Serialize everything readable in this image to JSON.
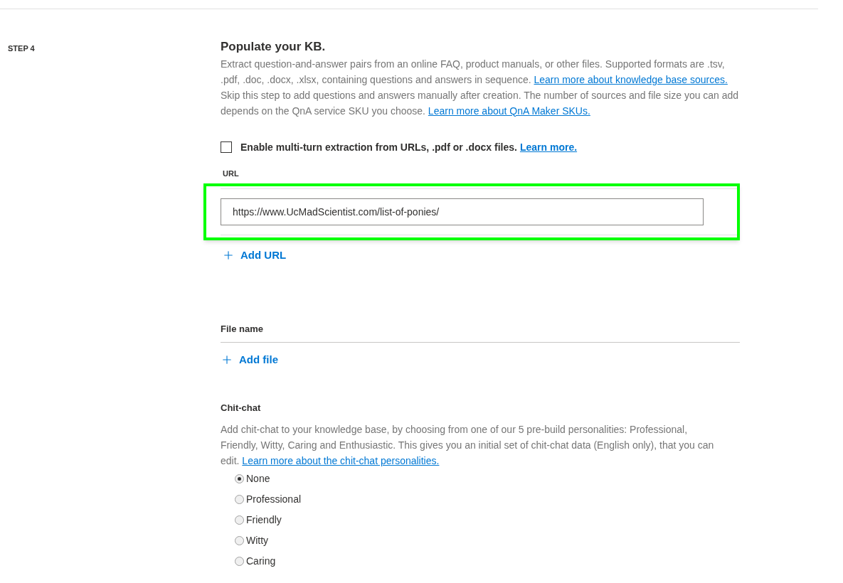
{
  "step_label": "STEP 4",
  "section_title": "Populate your KB.",
  "intro": [
    {
      "text": "Extract question-and-answer pairs from an online FAQ, product manuals, or other files. Supported formats are .tsv, .pdf, .doc, .docx, .xlsx, containing questions and answers in sequence. ",
      "kind": "text"
    },
    {
      "text": "Learn more about knowledge base sources.",
      "kind": "link"
    },
    {
      "text": " Skip this step to add questions and answers manually after creation. The number of sources and file size you can add depends on the QnA service SKU you choose. ",
      "kind": "text"
    },
    {
      "text": "Learn more about QnA Maker SKUs.",
      "kind": "link"
    }
  ],
  "multi_turn": {
    "checked": false,
    "label": "Enable multi-turn extraction from URLs, .pdf or .docx files.",
    "link": "Learn more."
  },
  "url_section": {
    "heading": "URL",
    "value": "https://www.UcMadScientist.com/list-of-ponies/",
    "highlighted": true,
    "add_label": "Add URL"
  },
  "file_section": {
    "heading": "File name",
    "add_label": "Add file"
  },
  "chit_chat": {
    "heading": "Chit-chat",
    "description": [
      {
        "text": "Add chit-chat to your knowledge base, by choosing from one of our 5 pre-build personalities: Professional, Friendly, Witty, Caring and Enthusiastic. This gives you an initial set of chit-chat data (English only), that you can edit. ",
        "kind": "text"
      },
      {
        "text": "Learn more about the chit-chat personalities.",
        "kind": "link"
      }
    ],
    "options": [
      {
        "label": "None",
        "selected": true
      },
      {
        "label": "Professional",
        "selected": false
      },
      {
        "label": "Friendly",
        "selected": false
      },
      {
        "label": "Witty",
        "selected": false
      },
      {
        "label": "Caring",
        "selected": false
      }
    ]
  }
}
